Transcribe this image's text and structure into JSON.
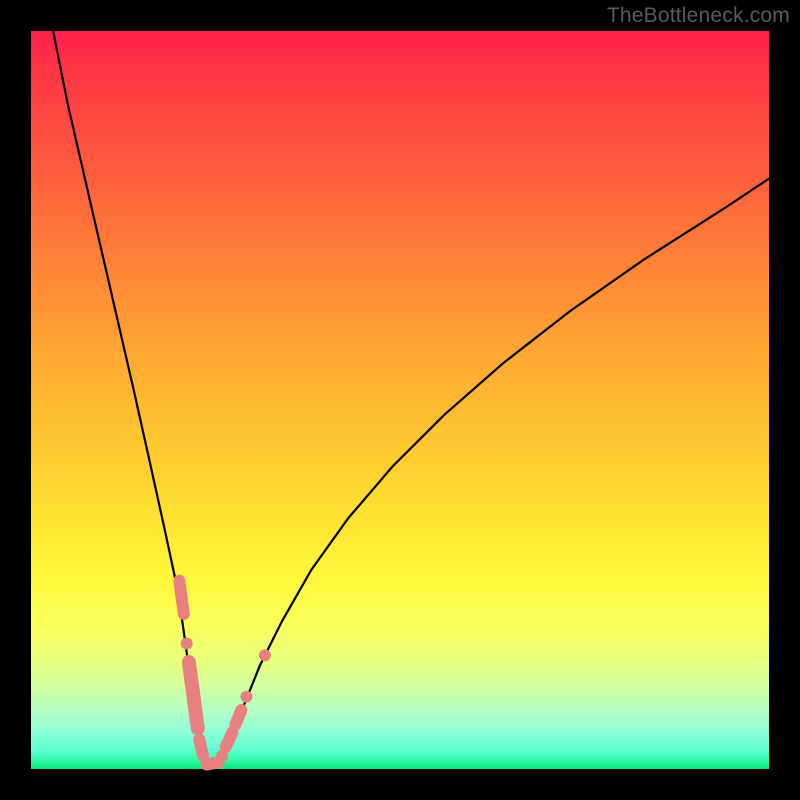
{
  "watermark": "TheBottleneck.com",
  "gradient_colors": {
    "top": "#ff1f4c",
    "mid_upper": "#ff8436",
    "mid": "#ffe232",
    "mid_lower": "#faff56",
    "bottom": "#0be676"
  },
  "chart_data": {
    "type": "line",
    "title": "",
    "xlabel": "",
    "ylabel": "",
    "xlim": [
      0,
      100
    ],
    "ylim": [
      0,
      100
    ],
    "x": [
      3,
      5,
      8,
      11,
      14,
      16,
      18,
      19.5,
      20.5,
      21.2,
      21.8,
      22.3,
      22.7,
      23,
      23.3,
      23.6,
      24,
      24.5,
      25,
      25.7,
      26.5,
      27.5,
      29,
      31,
      34,
      38,
      43,
      49,
      56,
      64,
      73,
      83,
      94,
      100
    ],
    "y": [
      100,
      90,
      77,
      64,
      51,
      42,
      33,
      26,
      20,
      15,
      11,
      8,
      5,
      3,
      2,
      1.2,
      0.7,
      0.5,
      0.7,
      1.5,
      3,
      5.5,
      9,
      14,
      20,
      27,
      34,
      41,
      48,
      55,
      62,
      69,
      76,
      80
    ],
    "markers": [
      {
        "shape": "capsule",
        "x1": 20.1,
        "y1": 25.5,
        "x2": 20.7,
        "y2": 21.0,
        "r": 6
      },
      {
        "shape": "circle",
        "cx": 21.1,
        "cy": 17.0,
        "r": 6
      },
      {
        "shape": "capsule",
        "x1": 21.4,
        "y1": 14.5,
        "x2": 22.6,
        "y2": 5.5,
        "r": 7
      },
      {
        "shape": "capsule",
        "x1": 22.8,
        "y1": 4.0,
        "x2": 23.3,
        "y2": 1.8,
        "r": 6
      },
      {
        "shape": "capsule",
        "x1": 23.8,
        "y1": 0.6,
        "x2": 25.4,
        "y2": 0.9,
        "r": 6
      },
      {
        "shape": "circle",
        "cx": 25.9,
        "cy": 1.8,
        "r": 6
      },
      {
        "shape": "capsule",
        "x1": 26.4,
        "y1": 3.0,
        "x2": 27.3,
        "y2": 5.0,
        "r": 6
      },
      {
        "shape": "capsule",
        "x1": 27.7,
        "y1": 6.0,
        "x2": 28.5,
        "y2": 8.0,
        "r": 6
      },
      {
        "shape": "circle",
        "cx": 29.2,
        "cy": 9.8,
        "r": 6
      },
      {
        "shape": "circle",
        "cx": 31.7,
        "cy": 15.4,
        "r": 6
      }
    ],
    "marker_color": "#e98080",
    "curve_color": "#000000"
  }
}
